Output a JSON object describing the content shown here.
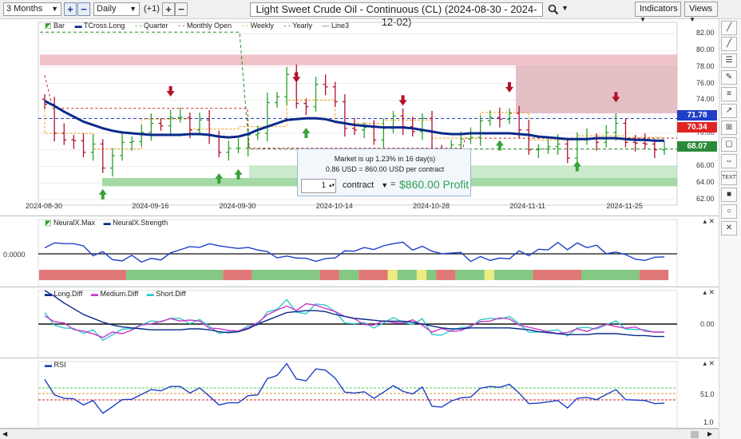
{
  "toolbar": {
    "period": "3 Months",
    "interval": "Daily",
    "offset": "(+1)",
    "plus_label": "+",
    "minus_label": "−",
    "title": "Light Sweet Crude Oil - Continuous (CL) (2024-08-30 - 2024-12-02)",
    "indicators_label": "Indicators",
    "views_label": "Views"
  },
  "icons": [
    "dropdown-arrow-icon",
    "search-icon",
    "line-tool-icon",
    "crosshair-icon",
    "close-icon",
    "pencil-icon",
    "ruler-icon",
    "rectangle-icon",
    "circle-icon",
    "text-icon"
  ],
  "price_pane": {
    "legend": [
      "Bar",
      "TCross.Long",
      "Quarter",
      "Monthly Open",
      "Weekly",
      "Yearly",
      "Line3"
    ],
    "y_ticks": [
      "82.00",
      "80.00",
      "78.00",
      "76.00",
      "74.00",
      "72.00",
      "70.00",
      "68.00",
      "66.00",
      "64.00",
      "62.00"
    ],
    "x_ticks": [
      "2024-08-30",
      "2024-09-16",
      "2024-09-30",
      "2024-10-14",
      "2024-10-28",
      "2024-11-11",
      "2024-11-25"
    ],
    "tags": [
      {
        "value": "71.78",
        "color": "#1f3fc8"
      },
      {
        "value": "70.34",
        "color": "#e02424"
      },
      {
        "value": "68.07",
        "color": "#2a8a3a"
      }
    ],
    "tooltip": {
      "line1": "Market is up 1.23% in 16 day(s)",
      "line2": "0.86 USD = 860.00 USD per contract",
      "qty": "1",
      "unit": "contract",
      "equals": "=",
      "profit": "$860.00 Profit"
    }
  },
  "neuralx_pane": {
    "legend": [
      "NeuralX.Max",
      "NeuralX.Strength"
    ],
    "y_label": "0.0000"
  },
  "diff_pane": {
    "legend": [
      "Long.Diff",
      "Medium.Diff",
      "Short.Diff"
    ],
    "y_label": "0.00"
  },
  "rsi_pane": {
    "legend": [
      "RSI"
    ],
    "y_labels": [
      "51.0",
      "1.0"
    ]
  },
  "colors": {
    "blue_line": "#0a2a8a",
    "up_bar": "#2aa12a",
    "down_bar": "#b2102a",
    "magenta": "#c838c8",
    "cyan": "#30c8c8",
    "green_band": "#7dbf7d",
    "red_band": "#d98a8a"
  },
  "chart_data": [
    {
      "type": "line",
      "title": "Light Sweet Crude Oil - Continuous (CL) (2024-08-30 - 2024-12-02)",
      "x": [
        "2024-08-30",
        "2024-09-03",
        "2024-09-04",
        "2024-09-05",
        "2024-09-06",
        "2024-09-09",
        "2024-09-10",
        "2024-09-11",
        "2024-09-12",
        "2024-09-13",
        "2024-09-16",
        "2024-09-17",
        "2024-09-18",
        "2024-09-19",
        "2024-09-20",
        "2024-09-23",
        "2024-09-24",
        "2024-09-25",
        "2024-09-26",
        "2024-09-27",
        "2024-09-30",
        "2024-10-01",
        "2024-10-02",
        "2024-10-03",
        "2024-10-04",
        "2024-10-07",
        "2024-10-08",
        "2024-10-09",
        "2024-10-10",
        "2024-10-11",
        "2024-10-14",
        "2024-10-15",
        "2024-10-16",
        "2024-10-17",
        "2024-10-18",
        "2024-10-21",
        "2024-10-22",
        "2024-10-23",
        "2024-10-24",
        "2024-10-25",
        "2024-10-28",
        "2024-10-29",
        "2024-10-30",
        "2024-10-31",
        "2024-11-01",
        "2024-11-04",
        "2024-11-05",
        "2024-11-06",
        "2024-11-07",
        "2024-11-08",
        "2024-11-11",
        "2024-11-12",
        "2024-11-13",
        "2024-11-14",
        "2024-11-15",
        "2024-11-18",
        "2024-11-19",
        "2024-11-20",
        "2024-11-21",
        "2024-11-22",
        "2024-11-25",
        "2024-11-26",
        "2024-11-27",
        "2024-11-29",
        "2024-12-02"
      ],
      "series": [
        {
          "name": "Bar",
          "values": [
            73.5,
            70.0,
            69.2,
            69.1,
            67.7,
            68.7,
            65.8,
            67.3,
            68.9,
            69.0,
            70.1,
            71.2,
            70.9,
            71.9,
            71.9,
            70.4,
            71.6,
            69.7,
            67.7,
            68.2,
            68.2,
            69.8,
            70.0,
            73.7,
            74.4,
            77.1,
            73.6,
            73.2,
            75.9,
            75.6,
            73.8,
            70.6,
            70.4,
            70.7,
            69.2,
            70.6,
            72.1,
            70.8,
            70.2,
            71.8,
            67.4,
            67.2,
            68.6,
            69.3,
            69.5,
            71.5,
            71.9,
            71.7,
            72.4,
            70.4,
            68.0,
            68.1,
            68.4,
            68.7,
            67.0,
            69.2,
            69.4,
            68.9,
            70.1,
            71.2,
            68.9,
            68.8,
            68.7,
            68.0,
            68.1
          ]
        },
        {
          "name": "TCross.Long",
          "values": [
            73.9,
            73.3,
            72.6,
            72.0,
            71.4,
            71.0,
            70.6,
            70.3,
            70.1,
            70.0,
            69.9,
            69.8,
            69.8,
            69.8,
            69.8,
            69.9,
            69.9,
            69.8,
            69.6,
            69.5,
            69.6,
            69.9,
            70.4,
            70.8,
            71.2,
            71.6,
            71.7,
            71.8,
            71.8,
            71.7,
            71.4,
            71.2,
            71.0,
            70.9,
            70.8,
            70.7,
            70.7,
            70.7,
            70.6,
            70.4,
            70.2,
            70.0,
            69.9,
            69.9,
            70.0,
            70.0,
            70.0,
            70.0,
            70.0,
            69.9,
            69.8,
            69.6,
            69.5,
            69.4,
            69.3,
            69.3,
            69.3,
            69.4,
            69.4,
            69.4,
            69.3,
            69.2,
            69.2,
            69.1,
            69.1
          ]
        }
      ],
      "ylim": [
        62,
        83
      ]
    }
  ]
}
